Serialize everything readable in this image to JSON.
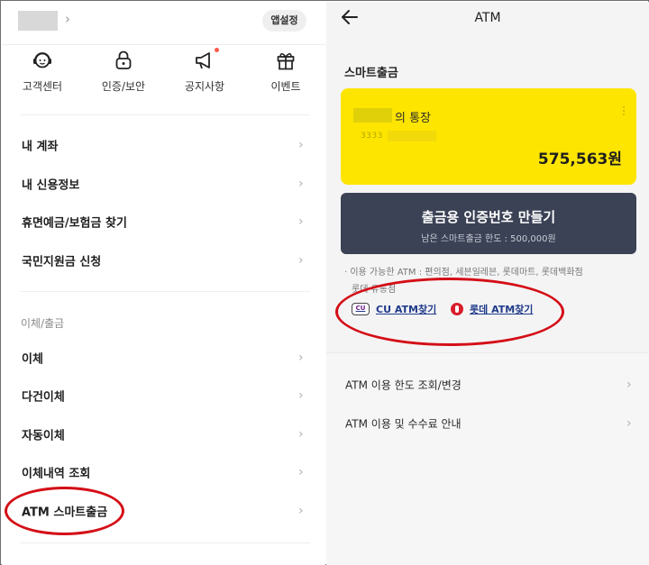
{
  "left": {
    "app_settings_label": "앱설정",
    "quick_menu": [
      {
        "label": "고객센터",
        "icon": "headset-icon"
      },
      {
        "label": "인증/보안",
        "icon": "lock-icon"
      },
      {
        "label": "공지사항",
        "icon": "megaphone-icon",
        "has_new_dot": true
      },
      {
        "label": "이벤트",
        "icon": "gift-icon"
      }
    ],
    "menu_group_1": [
      "내 계좌",
      "내 신용정보",
      "휴면예금/보험금 찾기",
      "국민지원금 신청"
    ],
    "section_label": "이체/출금",
    "menu_group_2": [
      "이체",
      "다건이체",
      "자동이체",
      "이체내역 조회",
      "ATM 스마트출금"
    ],
    "chevron": "›"
  },
  "right": {
    "title": "ATM",
    "section_title": "스마트출금",
    "account": {
      "name_suffix": "의 통장",
      "number_prefix": "3333",
      "balance": "575,563원"
    },
    "cert_button": {
      "label": "출금용 인증번호 만들기",
      "sub": "남은 스마트출금 한도 : 500,000원"
    },
    "note_line1": "· 이용 가능한 ATM : 편의점, 세븐일레븐, 롯데마트, 롯데백화점",
    "note_line2": "롯데 유통점",
    "links": {
      "cu_logo_text": "CU",
      "cu_label": "CU ATM찾기",
      "lotte_label": "롯데 ATM찾기"
    },
    "info_items": [
      "ATM 이용 한도 조회/변경",
      "ATM 이용 및 수수료 안내"
    ],
    "chevron": "›"
  },
  "colors": {
    "card_yellow": "#fee500",
    "button_navy": "#3b4255",
    "annotation_red": "#d40e16",
    "link_blue": "#1f3b8a",
    "notice_dot": "#ff5a4a"
  }
}
